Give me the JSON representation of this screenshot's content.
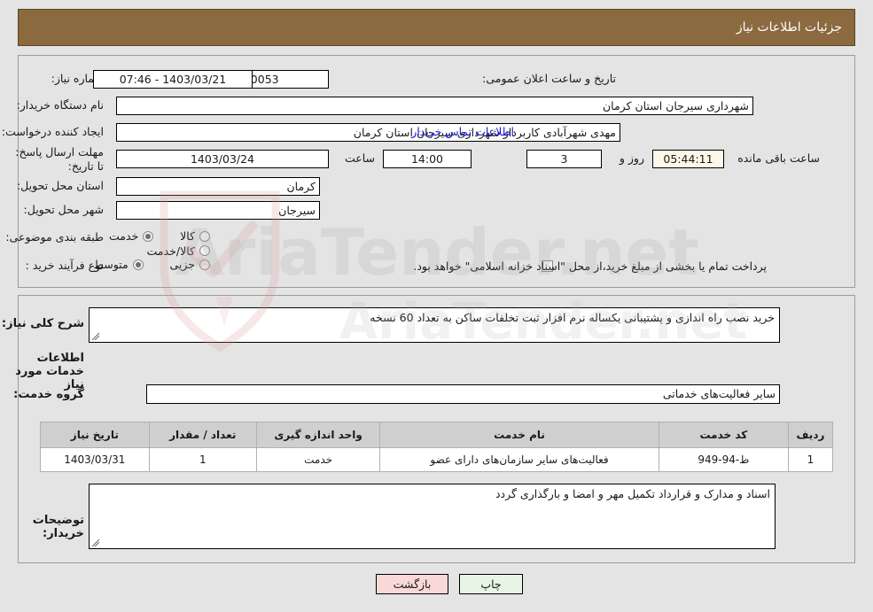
{
  "header": {
    "title": "جزئیات اطلاعات نیاز"
  },
  "top_panel": {
    "need_number": {
      "label": "شماره نیاز:",
      "value": "1103005674000053"
    },
    "announce_datetime": {
      "label": "تاریخ و ساعت اعلان عمومی:",
      "value": "1403/03/21 - 07:46"
    },
    "buyer_org": {
      "label": "نام دستگاه خریدار:",
      "value": "شهرداری سیرجان استان کرمان"
    },
    "requester": {
      "label": "ایجاد کننده درخواست:",
      "value": "مهدی شهرآبادی کاربرداز شهرداری سیرجان استان کرمان"
    },
    "buyer_contact_link": "اطلاعات تماس خریدار",
    "deadline": {
      "label": "مهلت ارسال پاسخ: تا تاریخ:",
      "date": "1403/03/24",
      "time_label": "ساعت",
      "time": "14:00",
      "days": "3",
      "days_label": "روز و",
      "remaining": "05:44:11",
      "remaining_label": "ساعت باقی مانده"
    },
    "delivery_province": {
      "label": "استان محل تحویل:",
      "value": "کرمان"
    },
    "delivery_city": {
      "label": "شهر محل تحویل:",
      "value": "سیرجان"
    },
    "classification": {
      "label": "طبقه بندی موضوعی:",
      "options": [
        {
          "label": "کالا",
          "selected": false
        },
        {
          "label": "خدمت",
          "selected": true
        },
        {
          "label": "کالا/خدمت",
          "selected": false
        }
      ]
    },
    "purchase_process": {
      "label": "نوع فرآیند خرید :",
      "options": [
        {
          "label": "جزیی",
          "selected": false
        },
        {
          "label": "متوسط",
          "selected": true
        }
      ],
      "treasury_checkbox": {
        "checked": false,
        "text": "پرداخت تمام یا بخشی از مبلغ خرید،از محل \"اسناد خزانه اسلامی\" خواهد بود."
      }
    }
  },
  "bottom_panel": {
    "general_desc": {
      "label": "شرح کلی نیاز:",
      "value": "خرید نصب راه اندازی  و پشتیبانی  یکساله نرم افزار ثبت تخلفات ساکن به تعداد 60 نسخه"
    },
    "services_section_title": "اطلاعات خدمات مورد نیاز",
    "service_group": {
      "label": "گروه خدمت:",
      "value": "سایر فعالیت‌های خدماتی"
    },
    "table": {
      "columns": [
        "ردیف",
        "کد خدمت",
        "نام خدمت",
        "واحد اندازه گیری",
        "تعداد / مقدار",
        "تاریخ نیاز"
      ],
      "rows": [
        {
          "row": "1",
          "code": "ط-94-949",
          "name": "فعالیت‌های سایر سازمان‌های دارای عضو",
          "unit": "خدمت",
          "quantity": "1",
          "need_date": "1403/03/31"
        }
      ]
    },
    "buyer_notes": {
      "label": "توضیحات خریدار:",
      "value": "اسناد و مدارک و قرارداد تکمیل مهر و امضا و بارگذاری گردد"
    }
  },
  "footer": {
    "print_label": "چاپ",
    "back_label": "بازگشت"
  },
  "watermark": {
    "text": "AriaTender.net"
  },
  "colors": {
    "header_bg": "#8b6a3f",
    "page_bg": "#e4e4e4",
    "link": "#1414d2",
    "print_btn": "#e6f5e6",
    "back_btn": "#fbd8d8",
    "table_header": "#cfcfcf"
  }
}
